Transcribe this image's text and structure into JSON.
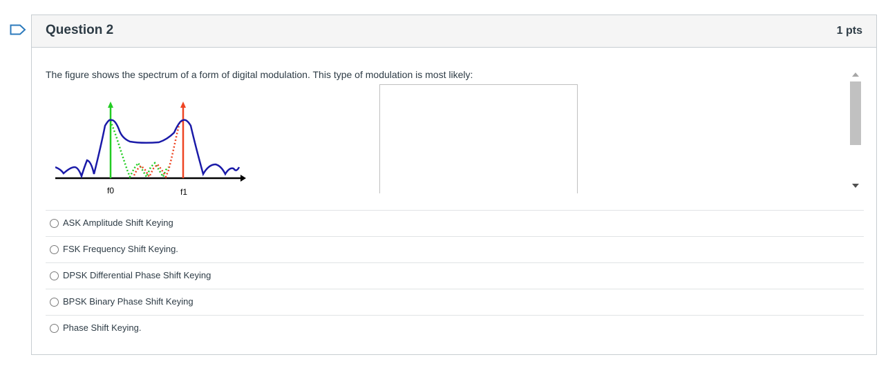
{
  "question": {
    "title": "Question 2",
    "points": "1 pts",
    "prompt": "The figure shows the spectrum of a form of digital modulation. This type of modulation is most likely:",
    "figure": {
      "labels": [
        "f0",
        "f1"
      ],
      "colors": {
        "envelope": "#1a1aa8",
        "f0_line": "#22cc22",
        "f1_line": "#ee4422",
        "axis": "#000000"
      }
    },
    "answers": [
      {
        "label": "ASK Amplitude Shift Keying"
      },
      {
        "label": "FSK Frequency Shift Keying."
      },
      {
        "label": "DPSK Differential Phase Shift Keying"
      },
      {
        "label": "BPSK Binary Phase Shift Keying"
      },
      {
        "label": "Phase Shift Keying."
      }
    ]
  },
  "colors": {
    "flag": "#2b7abc",
    "border": "#c7cdd1",
    "header_bg": "#f5f5f5",
    "text": "#2d3b45"
  },
  "icons": [
    "bookmark-flag-icon",
    "scroll-up-arrow-icon",
    "scroll-down-arrow-icon",
    "radio-icon"
  ]
}
